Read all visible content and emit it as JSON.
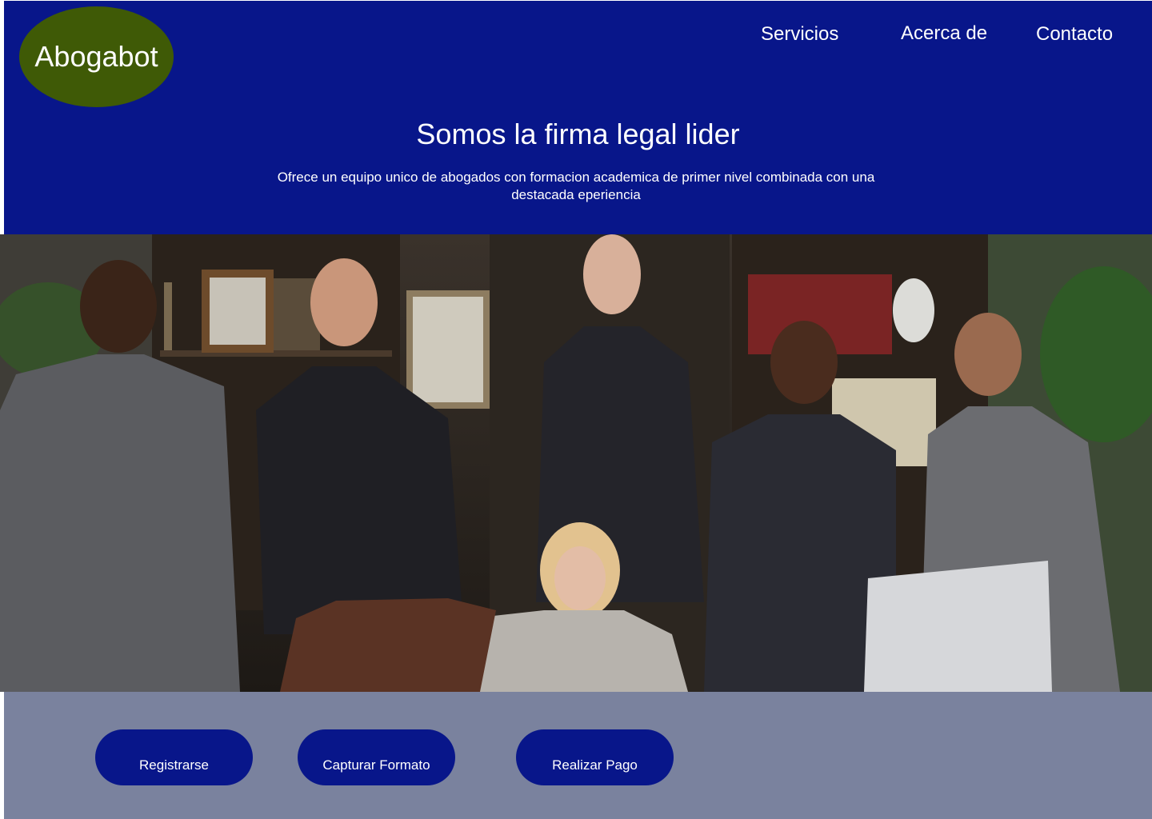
{
  "brand": {
    "logo_text": "Abogabot",
    "color": "#3f5a06"
  },
  "nav": {
    "services": "Servicios",
    "about": "Acerca de",
    "contact": "Contacto"
  },
  "hero": {
    "title": "Somos la firma legal lider",
    "subtitle": "Ofrece un equipo unico de abogados con formacion academica de primer nivel combinada con una destacada eperiencia"
  },
  "photo": {
    "subject": "team-of-lawyers-photo"
  },
  "actions": {
    "register": "Registrarse",
    "capture_format": "Capturar Formato",
    "make_payment": "Realizar Pago"
  },
  "colors": {
    "header_bg": "#08168a",
    "footer_bg": "#7a829e",
    "button_bg": "#08168a",
    "text": "#ffffff"
  }
}
